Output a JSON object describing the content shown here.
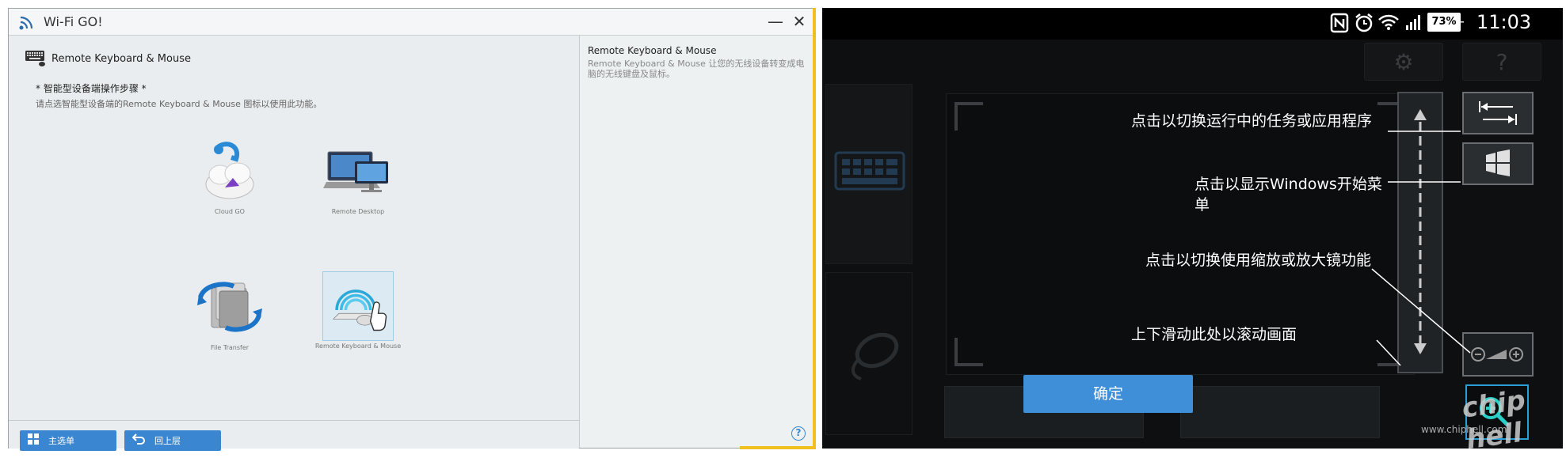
{
  "window": {
    "title": "Wi-Fi GO!",
    "minimize_glyph": "—",
    "close_glyph": "✕"
  },
  "feature": {
    "title": "Remote Keyboard & Mouse",
    "steps_title": "* 智能型设备端操作步骤 *",
    "steps_desc": "请点选智能型设备端的Remote Keyboard & Mouse 图标以使用此功能。"
  },
  "tiles": [
    {
      "label": "Cloud GO",
      "icon": "cloud-go-icon"
    },
    {
      "label": "Remote Desktop",
      "icon": "remote-desktop-icon"
    },
    {
      "label": "File Transfer",
      "icon": "file-transfer-icon"
    },
    {
      "label": "Remote Keyboard & Mouse",
      "icon": "remote-keyboard-mouse-icon",
      "selected": true
    }
  ],
  "right_panel": {
    "title": "Remote Keyboard & Mouse",
    "desc": "Remote Keyboard & Mouse 让您的无线设备转变成电脑的无线键盘及鼠标。"
  },
  "bottom": {
    "main_menu": "主选单",
    "back": "回上层",
    "help": "?"
  },
  "phone": {
    "time": "11:03",
    "battery": "73%",
    "annotations": {
      "switch_tasks": "点击以切换运行中的任务或应用程序",
      "windows_start": "点击以显示Windows开始菜单",
      "zoom": "点击以切换使用缩放或放大镜功能",
      "scroll": "上下滑动此处以滚动画面"
    },
    "confirm": "确定",
    "watermark": "www.chiphell.com",
    "logo": "chip hell"
  },
  "colors": {
    "accent_blue": "#3a86d1",
    "window_border_accent": "#f0c020",
    "phone_confirm": "#3f8fd8"
  }
}
